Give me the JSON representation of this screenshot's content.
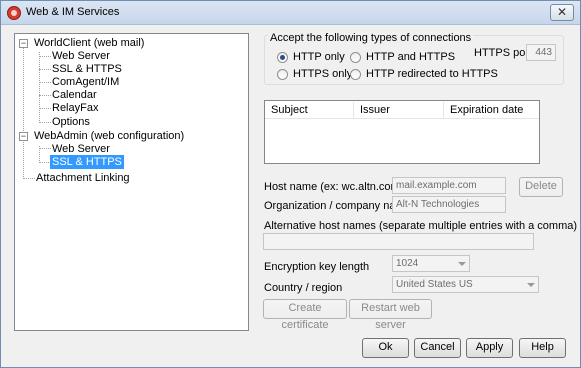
{
  "window": {
    "title": "Web & IM Services",
    "close_glyph": "✕"
  },
  "tree": {
    "nodes": [
      {
        "label": "WorldClient (web mail)",
        "expander": "−"
      },
      {
        "label": "Web Server"
      },
      {
        "label": "SSL & HTTPS"
      },
      {
        "label": "ComAgent/IM"
      },
      {
        "label": "Calendar"
      },
      {
        "label": "RelayFax"
      },
      {
        "label": "Options"
      },
      {
        "label": "WebAdmin (web configuration)",
        "expander": "−"
      },
      {
        "label": "Web Server"
      },
      {
        "label": "SSL & HTTPS",
        "selected": true
      },
      {
        "label": "Attachment Linking"
      }
    ]
  },
  "connections": {
    "group_label": "Accept the following types of connections",
    "options": [
      {
        "label": "HTTP only",
        "checked": true
      },
      {
        "label": "HTTPS only",
        "checked": false
      },
      {
        "label": "HTTP and HTTPS",
        "checked": false
      },
      {
        "label": "HTTP redirected to HTTPS",
        "checked": false
      }
    ],
    "https_port_label": "HTTPS port",
    "https_port_value": "443"
  },
  "certificates": {
    "columns": [
      "Subject",
      "Issuer",
      "Expiration date"
    ]
  },
  "form": {
    "host_name_label": "Host name (ex: wc.altn.com)",
    "host_name_value": "mail.example.com",
    "delete_label": "Delete",
    "org_label": "Organization / company name",
    "org_value": "Alt-N Technologies",
    "alt_hosts_label": "Alternative host names (separate multiple entries with a comma)",
    "alt_hosts_value": "",
    "key_length_label": "Encryption key length",
    "key_length_value": "1024",
    "country_label": "Country / region",
    "country_value": "United States US",
    "create_cert_label": "Create certificate",
    "restart_label": "Restart web server"
  },
  "footer": {
    "ok": "Ok",
    "cancel": "Cancel",
    "apply": "Apply",
    "help": "Help"
  },
  "colors": {
    "selection": "#3399ff",
    "title_gradient_top": "#dbe6f4"
  }
}
